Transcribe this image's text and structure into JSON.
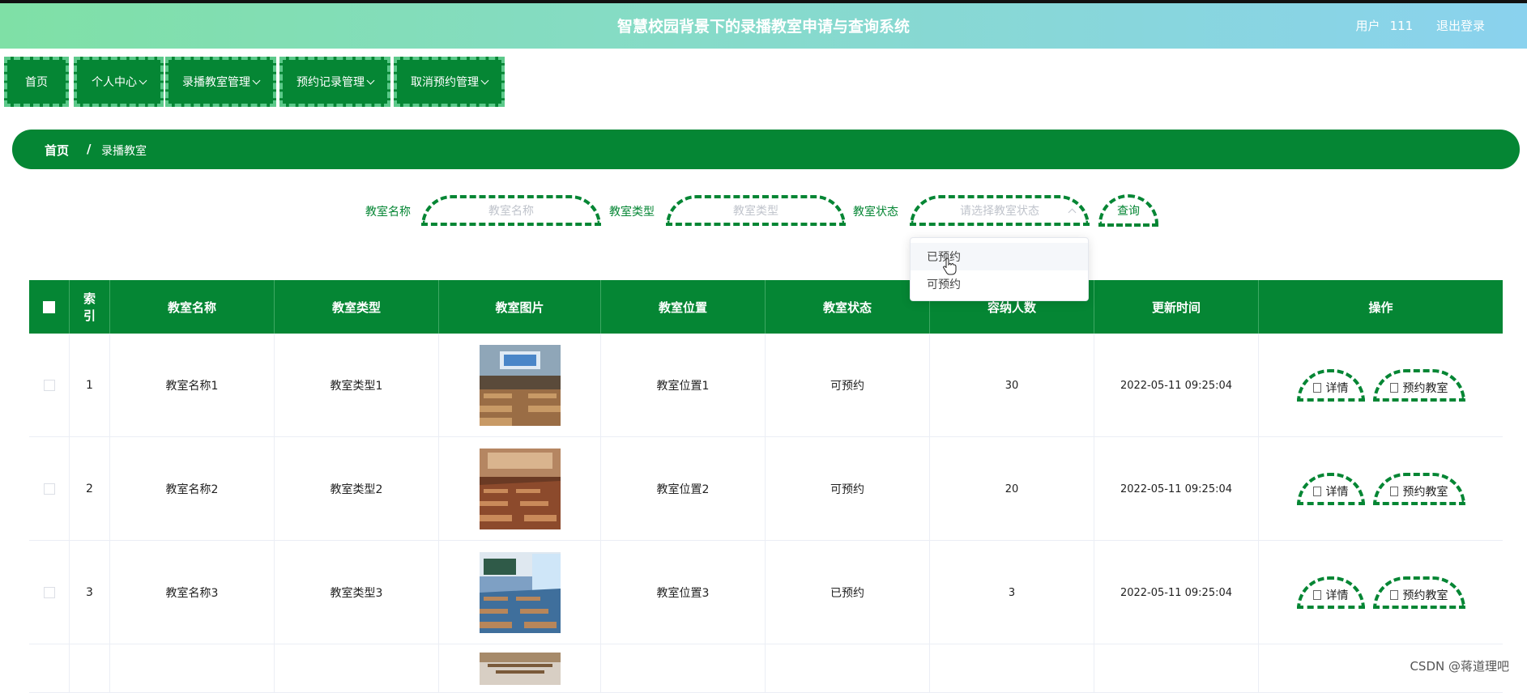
{
  "header": {
    "title": "智慧校园背景下的录播教室申请与查询系统",
    "user_label": "用户",
    "user_name": "111",
    "logout": "退出登录"
  },
  "nav": [
    {
      "label": "首页"
    },
    {
      "label": "个人中心"
    },
    {
      "label": "录播教室管理"
    },
    {
      "label": "预约记录管理"
    },
    {
      "label": "取消预约管理"
    }
  ],
  "breadcrumb": {
    "home": "首页",
    "separator": "/",
    "current": "录播教室"
  },
  "search": {
    "name_label": "教室名称",
    "name_placeholder": "教室名称",
    "type_label": "教室类型",
    "type_placeholder": "教室类型",
    "status_label": "教室状态",
    "status_placeholder": "请选择教室状态",
    "query_label": "查询"
  },
  "status_dropdown": {
    "options": [
      "已预约",
      "可预约"
    ]
  },
  "table": {
    "headers": [
      "索引",
      "教室名称",
      "教室类型",
      "教室图片",
      "教室位置",
      "教室状态",
      "容纳人数",
      "更新时间",
      "操作"
    ],
    "rows": [
      {
        "index": "1",
        "name": "教室名称1",
        "type": "教室类型1",
        "location": "教室位置1",
        "status": "可预约",
        "capacity": "30",
        "updated": "2022-05-11 09:25:04"
      },
      {
        "index": "2",
        "name": "教室名称2",
        "type": "教室类型2",
        "location": "教室位置2",
        "status": "可预约",
        "capacity": "20",
        "updated": "2022-05-11 09:25:04"
      },
      {
        "index": "3",
        "name": "教室名称3",
        "type": "教室类型3",
        "location": "教室位置3",
        "status": "已预约",
        "capacity": "3",
        "updated": "2022-05-11 09:25:04"
      }
    ],
    "actions": {
      "detail": "详情",
      "reserve": "预约教室"
    }
  },
  "watermark": "CSDN @蒋道理吧",
  "colors": {
    "primary": "#058634",
    "header_gradient_start": "#7fe0a6",
    "header_gradient_end": "#8ad2ee"
  }
}
